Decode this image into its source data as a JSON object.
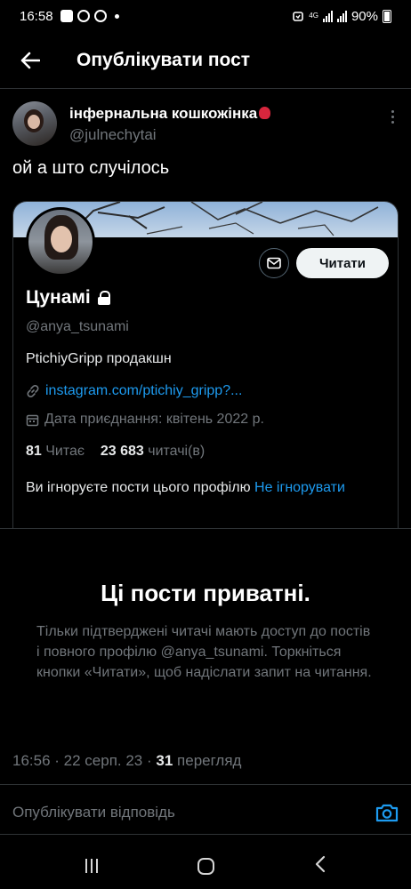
{
  "status_bar": {
    "time": "16:58",
    "network_small": "4G",
    "battery_percent": "90%"
  },
  "header": {
    "title": "Опублікувати пост"
  },
  "post": {
    "author_name": "інфернальна кошкожінка",
    "author_handle": "@julnechytai",
    "text": "ой а што случілось"
  },
  "profile_card": {
    "follow_label": "Читати",
    "display_name": "Цунамі",
    "handle": "@anya_tsunami",
    "bio": "PtichiyGripp продакшн",
    "link": "instagram.com/ptichiy_gripp?...",
    "joined": "Дата приєднання: квітень 2022 р.",
    "following_count": "81",
    "following_label": "Читає",
    "followers_count": "23 683",
    "followers_label": "читачі(в)",
    "ignore_notice": "Ви ігноруєте пости цього профілю",
    "unignore_label": "Не ігнорувати"
  },
  "private_notice": {
    "heading": "Ці пости приватні.",
    "description": "Тільки підтверджені читачі мають доступ до постів і повного профілю @anya_tsunami. Торкніться кнопки «Читати», щоб надіслати запит на читання."
  },
  "post_meta": {
    "time_date": "16:56 · 22 серп. 23 ·",
    "views_count": "31",
    "views_label": "перегляд"
  },
  "reply": {
    "placeholder": "Опублікувати відповідь"
  },
  "colors": {
    "background": "#000000",
    "accent": "#1d9bf0",
    "muted_text": "#71767b",
    "divider": "#2f3336"
  }
}
